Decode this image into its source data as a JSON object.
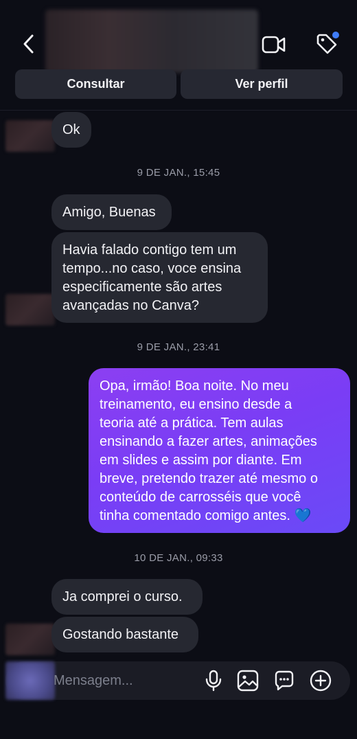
{
  "header": {
    "buttons": {
      "consult": "Consultar",
      "profile": "Ver perfil"
    },
    "icons": {
      "back": "chevron-left-icon",
      "video": "video-camera-icon",
      "tag": "tag-icon"
    }
  },
  "messages": [
    {
      "type": "in",
      "text": "Ok"
    },
    {
      "type": "stamp",
      "text": "9 DE JAN., 15:45"
    },
    {
      "type": "in",
      "text": "Amigo, Buenas"
    },
    {
      "type": "in",
      "lines": [
        "Havia falado contigo tem um",
        "tempo...no caso, voce ensina",
        "especificamente são artes",
        "avançadas no Canva?"
      ]
    },
    {
      "type": "stamp",
      "text": "9 DE JAN., 23:41"
    },
    {
      "type": "out",
      "lines": [
        "Opa, irmão! Boa noite. No meu",
        "treinamento, eu ensino desde a",
        "teoria até a prática. Tem aulas",
        "ensinando a fazer artes, animações",
        "em slides e assim por diante. Em",
        "breve, pretendo trazer até mesmo o",
        "conteúdo de carrosséis que você",
        "tinha comentado comigo antes. 💙"
      ]
    },
    {
      "type": "stamp",
      "text": "10 DE JAN., 09:33"
    },
    {
      "type": "in",
      "text": "Ja comprei o curso."
    },
    {
      "type": "in",
      "text": "Gostando bastante"
    }
  ],
  "composer": {
    "placeholder": "Mensagem...",
    "icons": [
      "microphone-icon",
      "image-icon",
      "chat-bubble-icon",
      "plus-circle-icon"
    ]
  },
  "colors": {
    "background": "#0c0d15",
    "incoming_bubble": "#262831",
    "outgoing_start": "#8c3ff2",
    "outgoing_end": "#6a4af7",
    "notification_dot": "#3f7cf7"
  }
}
